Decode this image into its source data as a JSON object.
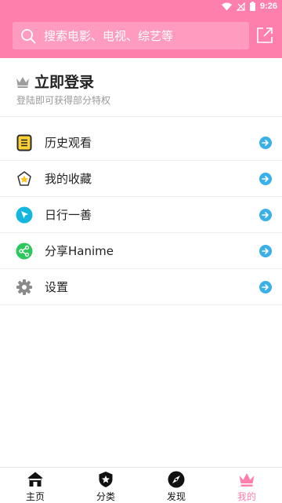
{
  "status_bar": {
    "time": "9:26"
  },
  "search": {
    "placeholder": "搜索电影、电视、综艺等"
  },
  "login": {
    "title": "立即登录",
    "subtitle": "登陆即可获得部分特权"
  },
  "menu": [
    {
      "label": "历史观看",
      "icon": "history-notebook-icon"
    },
    {
      "label": "我的收藏",
      "icon": "star-badge-icon"
    },
    {
      "label": "日行一善",
      "icon": "cursor-click-icon"
    },
    {
      "label": "分享Hanime",
      "icon": "share-icon"
    },
    {
      "label": "设置",
      "icon": "gear-icon"
    }
  ],
  "bottom_nav": [
    {
      "label": "主页",
      "icon": "home-icon",
      "active": false
    },
    {
      "label": "分类",
      "icon": "shield-star-icon",
      "active": false
    },
    {
      "label": "发现",
      "icon": "compass-icon",
      "active": false
    },
    {
      "label": "我的",
      "icon": "crown-icon",
      "active": true
    }
  ],
  "colors": {
    "accent": "#ff7fac",
    "arrow": "#3ab0e8",
    "nav_active": "#ff7fac"
  }
}
